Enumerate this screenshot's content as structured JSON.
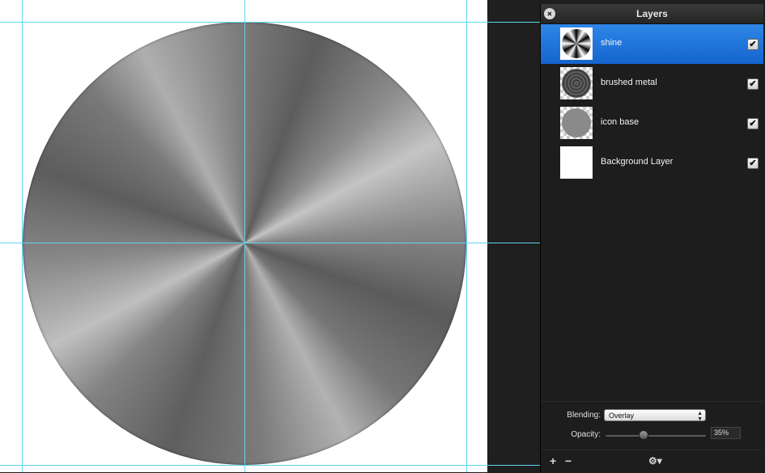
{
  "panel": {
    "title": "Layers"
  },
  "layers": [
    {
      "name": "shine",
      "visible": true,
      "selected": true,
      "thumbnail": "shine-thumbnail"
    },
    {
      "name": "brushed metal",
      "visible": true,
      "selected": false,
      "thumbnail": "brushed-metal-thumbnail"
    },
    {
      "name": "icon base",
      "visible": true,
      "selected": false,
      "thumbnail": "icon-base-thumbnail"
    },
    {
      "name": "Background Layer",
      "visible": true,
      "selected": false,
      "thumbnail": "white-thumbnail"
    }
  ],
  "properties": {
    "blending_label": "Blending:",
    "blending_value": "Overlay",
    "opacity_label": "Opacity:",
    "opacity_value": "35%"
  },
  "icons": {
    "close": "close-icon",
    "check": "✔",
    "add": "+",
    "remove": "−",
    "gear": "⚙▾"
  },
  "colors": {
    "selection": "#1a74e0",
    "guide": "#5fd3f0",
    "panel_bg": "#1d1d1d"
  }
}
